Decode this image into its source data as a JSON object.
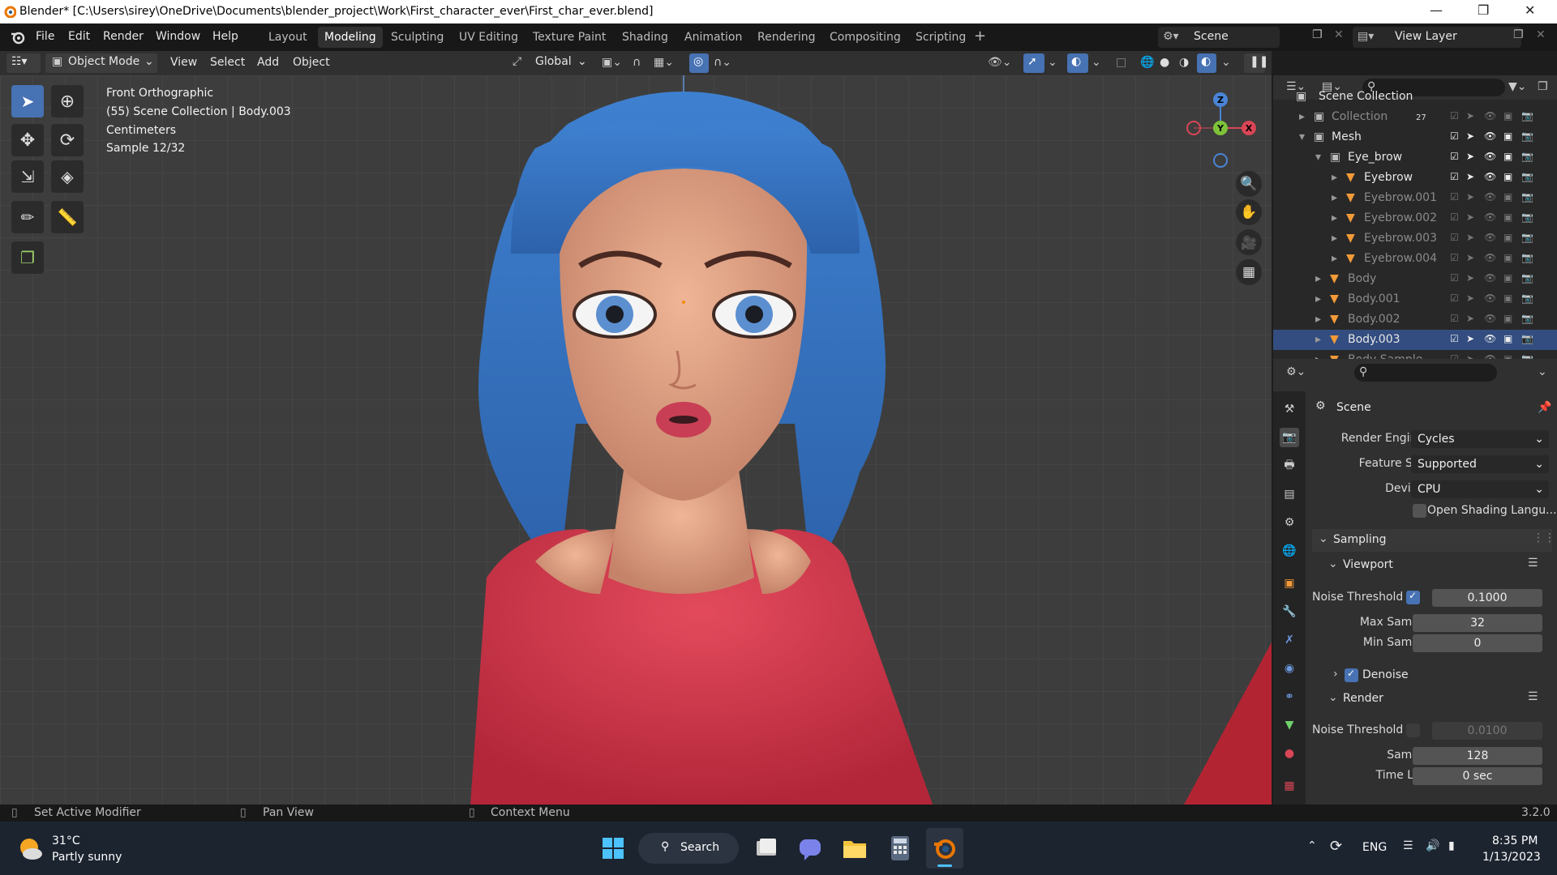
{
  "titlebar": {
    "title": "Blender* [C:\\Users\\sirey\\OneDrive\\Documents\\blender_project\\Work\\First_character_ever\\First_char_ever.blend]"
  },
  "menu": {
    "items": [
      "File",
      "Edit",
      "Render",
      "Window",
      "Help"
    ]
  },
  "workspaces": [
    "Layout",
    "Modeling",
    "Sculpting",
    "UV Editing",
    "Texture Paint",
    "Shading",
    "Animation",
    "Rendering",
    "Compositing",
    "Scripting"
  ],
  "active_workspace": "Modeling",
  "scene_name": "Scene",
  "view_layer": "View Layer",
  "header": {
    "mode": "Object Mode",
    "menus": [
      "View",
      "Select",
      "Add",
      "Object"
    ],
    "orientation": "Global"
  },
  "viewport": {
    "info": [
      "Front Orthographic",
      "(55) Scene Collection | Body.003",
      "Centimeters",
      "Sample 12/32"
    ],
    "gizmo": {
      "z": "Z",
      "y": "Y",
      "x": "X"
    }
  },
  "outliner": {
    "root": "Scene Collection",
    "rows": [
      {
        "label": "Collection",
        "badge": "27",
        "dim": true
      },
      {
        "label": "Mesh",
        "dim": false
      },
      {
        "label": "Eye_brow",
        "dim": false
      },
      {
        "label": "Eyebrow",
        "dim": false
      },
      {
        "label": "Eyebrow.001",
        "dim": true
      },
      {
        "label": "Eyebrow.002",
        "dim": true
      },
      {
        "label": "Eyebrow.003",
        "dim": true
      },
      {
        "label": "Eyebrow.004",
        "dim": true
      },
      {
        "label": "Body",
        "dim": true
      },
      {
        "label": "Body.001",
        "dim": true
      },
      {
        "label": "Body.002",
        "dim": true
      },
      {
        "label": "Body.003",
        "dim": false
      },
      {
        "label": "Body Sample",
        "dim": true
      }
    ]
  },
  "properties": {
    "context": "Scene",
    "render_engine_label": "Render Engine",
    "render_engine": "Cycles",
    "feature_set_label": "Feature Set",
    "feature_set": "Supported",
    "device_label": "Device",
    "device": "CPU",
    "osl_label": "Open Shading Langu...",
    "sampling": "Sampling",
    "viewport": "Viewport",
    "vp_noise_label": "Noise Threshold",
    "vp_noise": "0.1000",
    "vp_max_label": "Max Samples",
    "vp_max": "32",
    "vp_min_label": "Min Samples",
    "vp_min": "0",
    "denoise": "Denoise",
    "render": "Render",
    "r_noise_label": "Noise Threshold",
    "r_noise": "0.0100",
    "r_samples_label": "Samples",
    "r_samples": "128",
    "r_time_label": "Time Limit",
    "r_time": "0 sec"
  },
  "status": {
    "left": "Set Active Modifier",
    "mid": "Pan View",
    "right": "Context Menu",
    "version": "3.2.0"
  },
  "taskbar": {
    "temp": "31°C",
    "weather": "Partly sunny",
    "search": "Search",
    "lang": "ENG",
    "time": "8:35 PM",
    "date": "1/13/2023"
  },
  "colors": {
    "accent": "#4772b3",
    "hair": "#3a78c8",
    "skin": "#e0a184",
    "shirt": "#d9354a"
  }
}
